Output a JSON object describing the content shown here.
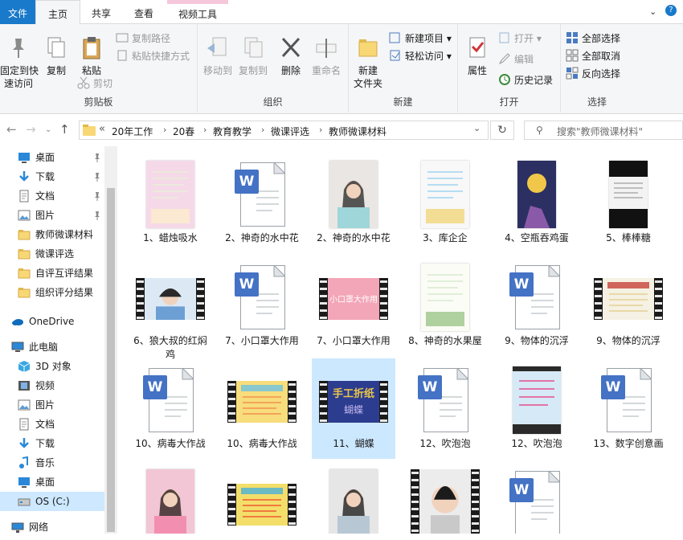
{
  "tabs": {
    "file": "文件",
    "home": "主页",
    "share": "共享",
    "view": "查看",
    "video_tools": "视频工具"
  },
  "ribbon": {
    "clipboard": {
      "pin": "固定到快\n速访问",
      "copy": "复制",
      "paste": "粘贴",
      "copy_path": "复制路径",
      "paste_shortcut": "粘贴快捷方式",
      "cut": "剪切",
      "label": "剪贴板"
    },
    "organize": {
      "move_to": "移动到",
      "copy_to": "复制到",
      "delete": "删除",
      "rename": "重命名",
      "label": "组织"
    },
    "new": {
      "new_folder": "新建\n文件夹",
      "new_item": "新建项目",
      "easy_access": "轻松访问",
      "label": "新建"
    },
    "open": {
      "properties": "属性",
      "open": "打开",
      "edit": "编辑",
      "history": "历史记录",
      "label": "打开"
    },
    "select": {
      "select_all": "全部选择",
      "select_none": "全部取消",
      "invert": "反向选择",
      "label": "选择"
    }
  },
  "address": {
    "crumbs": [
      "20年工作",
      "20春",
      "教育教学",
      "微课评选",
      "教师微课材料"
    ],
    "overflow": "«",
    "search_placeholder": "搜索\"教师微课材料\""
  },
  "nav": {
    "quick": [
      {
        "label": "桌面",
        "icon": "desktop-icon",
        "pinned": true
      },
      {
        "label": "下载",
        "icon": "download-icon",
        "pinned": true
      },
      {
        "label": "文档",
        "icon": "documents-icon",
        "pinned": true
      },
      {
        "label": "图片",
        "icon": "pictures-icon",
        "pinned": true
      },
      {
        "label": "教师微课材料",
        "icon": "folder-icon",
        "pinned": false
      },
      {
        "label": "微课评选",
        "icon": "folder-icon",
        "pinned": false
      },
      {
        "label": "自评互评结果",
        "icon": "folder-icon",
        "pinned": false
      },
      {
        "label": "组织评分结果",
        "icon": "folder-icon",
        "pinned": false
      }
    ],
    "onedrive": "OneDrive",
    "pc": "此电脑",
    "pc_items": [
      {
        "label": "3D 对象",
        "icon": "3d-objects-icon"
      },
      {
        "label": "视频",
        "icon": "videos-icon"
      },
      {
        "label": "图片",
        "icon": "pictures-icon"
      },
      {
        "label": "文档",
        "icon": "documents-icon"
      },
      {
        "label": "下载",
        "icon": "download-icon"
      },
      {
        "label": "音乐",
        "icon": "music-icon"
      },
      {
        "label": "桌面",
        "icon": "desktop-icon"
      },
      {
        "label": "OS (C:)",
        "icon": "drive-icon"
      }
    ],
    "network": "网络",
    "pin_glyph": "📌"
  },
  "files": [
    {
      "name": "1、蜡烛吸水",
      "kind": "image",
      "theme": "pastel"
    },
    {
      "name": "2、神奇的水中花",
      "kind": "word"
    },
    {
      "name": "2、神奇的水中花",
      "kind": "image",
      "theme": "portrait"
    },
    {
      "name": "3、库企企",
      "kind": "image",
      "theme": "doc-cartoon"
    },
    {
      "name": "4、空瓶吞鸡蛋",
      "kind": "image",
      "theme": "night"
    },
    {
      "name": "5、棒棒糖",
      "kind": "image",
      "theme": "dark-doc"
    },
    {
      "name": "6、狼大叔的红焖鸡",
      "kind": "video",
      "theme": "portrait-blue"
    },
    {
      "name": "7、小口罩大作用",
      "kind": "word"
    },
    {
      "name": "7、小口罩大作用",
      "kind": "video",
      "theme": "pink"
    },
    {
      "name": "8、神奇的水果屋",
      "kind": "image",
      "theme": "green-doc"
    },
    {
      "name": "9、物体的沉浮",
      "kind": "word"
    },
    {
      "name": "9、物体的沉浮",
      "kind": "video",
      "theme": "slide"
    },
    {
      "name": "10、病毒大作战",
      "kind": "word"
    },
    {
      "name": "10、病毒大作战",
      "kind": "video",
      "theme": "yellow-slide"
    },
    {
      "name": "11、蝴蝶",
      "kind": "video",
      "theme": "butterfly",
      "selected": true
    },
    {
      "name": "12、吹泡泡",
      "kind": "word"
    },
    {
      "name": "12、吹泡泡",
      "kind": "image",
      "theme": "blue-screen"
    },
    {
      "name": "13、数字创意画",
      "kind": "word"
    },
    {
      "name": "",
      "kind": "image",
      "theme": "portrait-pink"
    },
    {
      "name": "",
      "kind": "video",
      "theme": "yellow-slide2"
    },
    {
      "name": "",
      "kind": "image",
      "theme": "portrait-grey"
    },
    {
      "name": "",
      "kind": "video",
      "theme": "portrait-dark"
    },
    {
      "name": "",
      "kind": "word"
    }
  ],
  "colors": {
    "accent": "#1979ca",
    "selection": "#cce8ff",
    "word": "#4472c4",
    "folder": "#f8d775"
  }
}
